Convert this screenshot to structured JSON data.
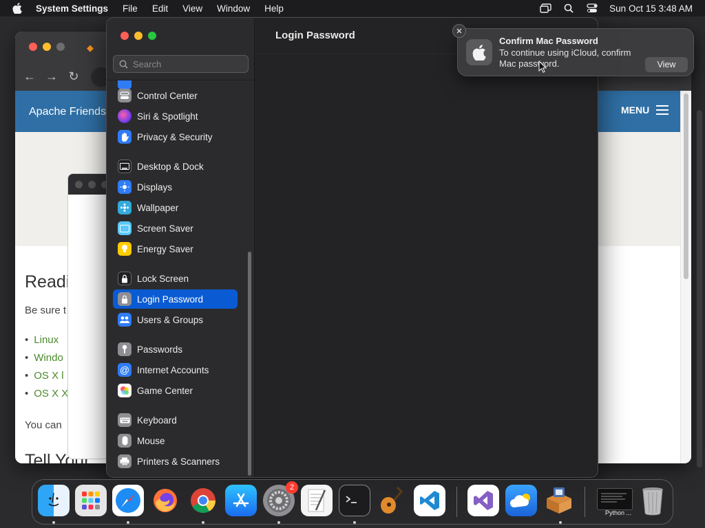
{
  "menubar": {
    "app_name": "System Settings",
    "menus": [
      "File",
      "Edit",
      "View",
      "Window",
      "Help"
    ],
    "clock": "Sun Oct 15  3:48 AM",
    "status_icons": [
      "screen-mirroring-icon",
      "spotlight-search-icon",
      "control-center-icon"
    ]
  },
  "browser": {
    "site_title": "Apache Friends",
    "menu_label": "MENU",
    "heading": "Readi",
    "text1": "Be sure t",
    "bullets": [
      "Linux",
      "Windo",
      "OS X l",
      "OS X X"
    ],
    "text2": "You can",
    "heading2": "Tell Your"
  },
  "settings": {
    "title": "Login Password",
    "search_placeholder": "Search",
    "sidebar_items": [
      {
        "label": "Control Center",
        "icon": "control-center-icon",
        "color": "#8e8e93"
      },
      {
        "label": "Siri & Spotlight",
        "icon": "siri-icon",
        "color": "#a44fd1"
      },
      {
        "label": "Privacy & Security",
        "icon": "hand-icon",
        "color": "#2f7cf6"
      },
      {
        "label": "Desktop & Dock",
        "icon": "dock-icon",
        "color": "#2c2c2e"
      },
      {
        "label": "Displays",
        "icon": "sun-icon",
        "color": "#2f7cf6"
      },
      {
        "label": "Wallpaper",
        "icon": "wallpaper-icon",
        "color": "#34aadc"
      },
      {
        "label": "Screen Saver",
        "icon": "screen-saver-icon",
        "color": "#5ac8fa"
      },
      {
        "label": "Energy Saver",
        "icon": "bulb-icon",
        "color": "#ffcc00"
      },
      {
        "label": "Lock Screen",
        "icon": "lock-icon",
        "color": "#2c2c2e"
      },
      {
        "label": "Login Password",
        "icon": "lock-icon",
        "color": "#8e8e93"
      },
      {
        "label": "Users & Groups",
        "icon": "users-icon",
        "color": "#2f7cf6"
      },
      {
        "label": "Passwords",
        "icon": "key-icon",
        "color": "#8e8e93"
      },
      {
        "label": "Internet Accounts",
        "icon": "at-icon",
        "color": "#2f7cf6"
      },
      {
        "label": "Game Center",
        "icon": "game-center-icon",
        "color": "#ffffff"
      },
      {
        "label": "Keyboard",
        "icon": "keyboard-icon",
        "color": "#8e8e93"
      },
      {
        "label": "Mouse",
        "icon": "mouse-icon",
        "color": "#8e8e93"
      },
      {
        "label": "Printers & Scanners",
        "icon": "printer-icon",
        "color": "#8e8e93"
      }
    ]
  },
  "notification": {
    "title": "Confirm Mac Password",
    "body": "To continue using iCloud, confirm Mac password.",
    "action_label": "View"
  },
  "dock": {
    "apps": [
      "Finder",
      "Launchpad",
      "Safari",
      "Firefox",
      "Chrome",
      "App Store",
      "System Settings",
      "TextEdit",
      "Terminal",
      "GarageBand",
      "Visual Studio Code",
      "Visual Studio",
      "iCloud",
      "Installer"
    ],
    "settings_badge": "2",
    "minimized_label": "Python ..."
  }
}
